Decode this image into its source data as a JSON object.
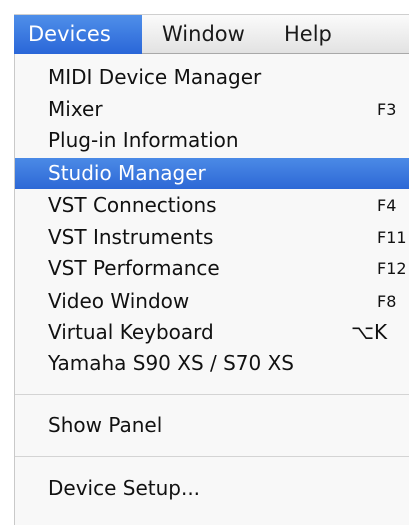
{
  "menubar": {
    "items": [
      {
        "label": "Devices"
      },
      {
        "label": "Window"
      },
      {
        "label": "Help"
      }
    ]
  },
  "dropdown": {
    "items": [
      {
        "label": "MIDI Device Manager",
        "shortcut": ""
      },
      {
        "label": "Mixer",
        "shortcut": "F3"
      },
      {
        "label": "Plug-in Information",
        "shortcut": ""
      },
      {
        "label": "Studio Manager",
        "shortcut": "",
        "highlighted": true
      },
      {
        "label": "VST Connections",
        "shortcut": "F4"
      },
      {
        "label": "VST Instruments",
        "shortcut": "F11"
      },
      {
        "label": "VST Performance",
        "shortcut": "F12"
      },
      {
        "label": "Video Window",
        "shortcut": "F8"
      },
      {
        "label": "Virtual Keyboard",
        "shortcut": "⌥K"
      },
      {
        "label": "Yamaha S90 XS / S70 XS",
        "shortcut": ""
      },
      {
        "label": "Show Panel",
        "shortcut": ""
      },
      {
        "label": "Device Setup...",
        "shortcut": ""
      }
    ]
  },
  "colors": {
    "highlight": "#2d68d6",
    "active_menu": "#2a66d8"
  }
}
